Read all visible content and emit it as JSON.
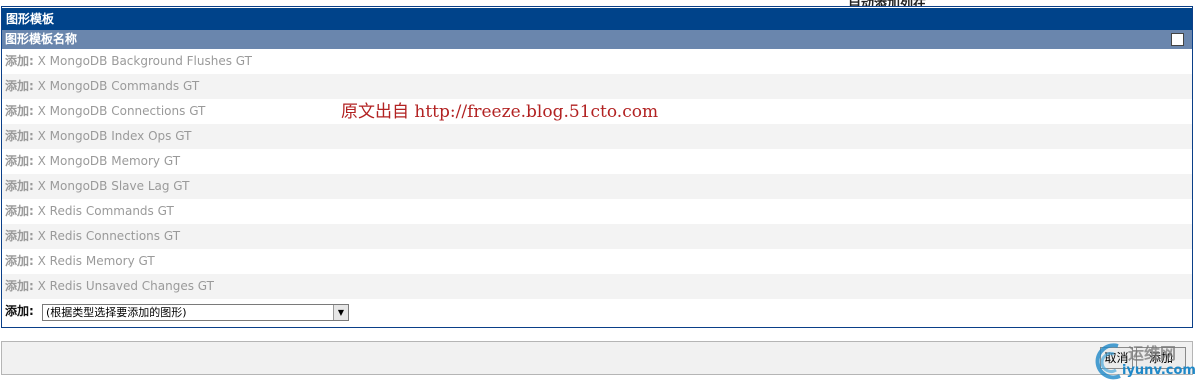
{
  "top_cut_text": "自动添加列在",
  "panel": {
    "title": "图形模板",
    "column_header": "图形模板名称"
  },
  "templates": [
    {
      "prefix": "添加:",
      "name": "X MongoDB Background Flushes GT"
    },
    {
      "prefix": "添加:",
      "name": "X MongoDB Commands GT"
    },
    {
      "prefix": "添加:",
      "name": "X MongoDB Connections GT"
    },
    {
      "prefix": "添加:",
      "name": "X MongoDB Index Ops GT"
    },
    {
      "prefix": "添加:",
      "name": "X MongoDB Memory GT"
    },
    {
      "prefix": "添加:",
      "name": "X MongoDB Slave Lag GT"
    },
    {
      "prefix": "添加:",
      "name": "X Redis Commands GT"
    },
    {
      "prefix": "添加:",
      "name": "X Redis Connections GT"
    },
    {
      "prefix": "添加:",
      "name": "X Redis Memory GT"
    },
    {
      "prefix": "添加:",
      "name": "X Redis Unsaved Changes GT"
    }
  ],
  "add_row": {
    "label": "添加:",
    "select_value": "(根据类型选择要添加的图形)"
  },
  "watermark": "原文出自 http://freeze.blog.51cto.com",
  "buttons": {
    "cancel": "取消",
    "add": "添加"
  },
  "logo": {
    "line1": "运维网",
    "line2": "iyunv.com"
  },
  "colors": {
    "header_bg": "#00438a",
    "column_header_bg": "#6a86ad",
    "watermark": "#b22222"
  }
}
